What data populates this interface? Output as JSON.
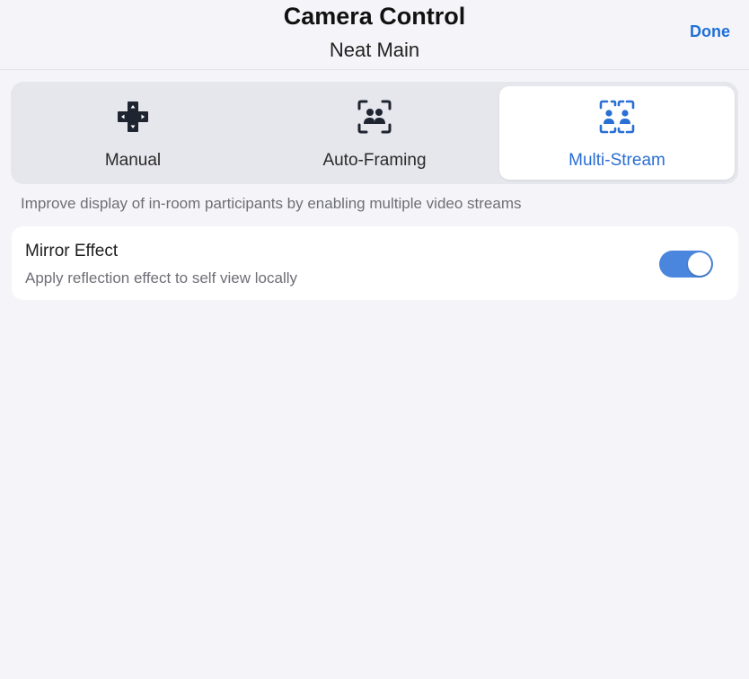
{
  "header": {
    "title": "Camera Control",
    "subtitle": "Neat Main",
    "done_label": "Done"
  },
  "modes": {
    "selected": "Multi-Stream",
    "items": [
      {
        "label": "Manual",
        "icon": "dpad-icon"
      },
      {
        "label": "Auto-Framing",
        "icon": "auto-framing-icon"
      },
      {
        "label": "Multi-Stream",
        "icon": "multi-stream-icon"
      }
    ]
  },
  "description": "Improve display of in-room participants by enabling multiple video streams",
  "mirror_effect": {
    "title": "Mirror Effect",
    "subtitle": "Apply reflection effect to self view locally",
    "enabled": true
  },
  "colors": {
    "accent": "#2a6fd4",
    "toggle_on": "#4a86dd",
    "background": "#f5f5f9"
  }
}
